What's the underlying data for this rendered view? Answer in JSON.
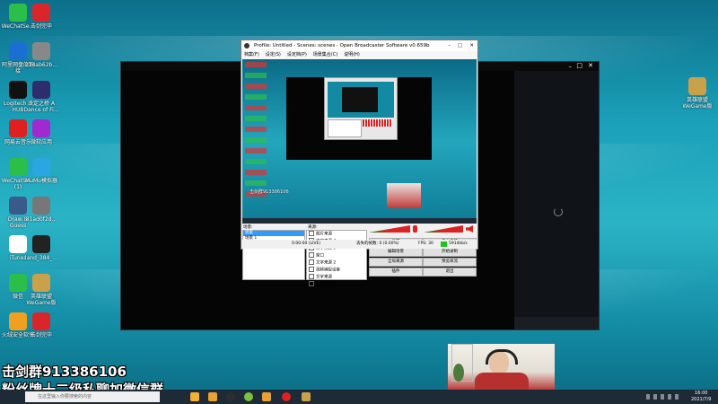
{
  "desktop_icons": [
    {
      "label": "WeChatSe...",
      "color": "#2bbf4a",
      "icon": "wechat-icon"
    },
    {
      "label": "击剑完毕",
      "color": "#d9262b",
      "icon": "app-icon"
    },
    {
      "label": "阿里网盘的链接",
      "color": "#1a6fd1",
      "icon": "app-icon"
    },
    {
      "label": "234ab62b...",
      "color": "#888888",
      "icon": "file-icon"
    },
    {
      "label": "Logitech G HUB",
      "color": "#111111",
      "icon": "logitech-icon"
    },
    {
      "label": "决定之桥 A Dance of Fi...",
      "color": "#2d2d6e",
      "icon": "game-icon"
    },
    {
      "label": "网易云音乐",
      "color": "#e02020",
      "icon": "music-icon"
    },
    {
      "label": "微软应用",
      "color": "#a02ad0",
      "icon": "app-icon"
    },
    {
      "label": "WeChatSe... (1)",
      "color": "#2bbf4a",
      "icon": "wechat-icon"
    },
    {
      "label": "MuMu模拟器",
      "color": "#2aa7e0",
      "icon": "emulator-icon"
    },
    {
      "label": "Draw & Guess",
      "color": "#3a5a8a",
      "icon": "pen-icon"
    },
    {
      "label": "81ad0f2d...",
      "color": "#777777",
      "icon": "file-icon"
    },
    {
      "label": "iTunes",
      "color": "#ffffff",
      "icon": "itunes-icon"
    },
    {
      "label": "land_384_...",
      "color": "#222222",
      "icon": "apk-icon"
    },
    {
      "label": "微信",
      "color": "#2bbf4a",
      "icon": "wechat-icon"
    },
    {
      "label": "英雄联盟 WeGame版",
      "color": "#c9a14a",
      "icon": "lol-icon"
    },
    {
      "label": "火绒安全软件",
      "color": "#f0a020",
      "icon": "shield-icon"
    },
    {
      "label": "击剑完毕",
      "color": "#d9262b",
      "icon": "app-icon"
    }
  ],
  "right_icon": {
    "label": "英雄联盟 WeGame版",
    "color": "#c9a14a"
  },
  "obs": {
    "title": "Profile: Untitled - Scenes: scenes - Open Broadcaster Software v0.659b",
    "menu": [
      "档案(F)",
      "设定(S)",
      "设定档(P)",
      "场景集合(C)",
      "说明(H)"
    ],
    "preview_overlay": "击剑群913386106",
    "scenes_label": "场景:",
    "scenes": [
      "场景",
      "场景 1",
      "场景 2"
    ],
    "sources_label": "来源:",
    "sources": [
      "图片来源",
      "文字来源 4",
      "文字来源 3",
      "窗口",
      "文字来源 2",
      "视频捕捉设备",
      "文字来源",
      "游戏源获取"
    ],
    "buttons": [
      "设定",
      "停止串流",
      "编辑场景",
      "开始录制",
      "全局来源",
      "预览串流",
      "插件",
      "退出"
    ],
    "status": {
      "time": "0:00:00 (LIVE)",
      "dropped": "丢失的帧数: 0 (0.00%)",
      "fps": "FPS: 30",
      "bitrate": "5914kb/s"
    }
  },
  "overlay_text": {
    "line1": "击剑群913386106",
    "line2": "粉丝牌十二级私聊加微信群"
  },
  "taskbar": {
    "search_placeholder": "在这里输入你要搜索的内容",
    "time": "16:00",
    "date": "2021/7/9"
  }
}
